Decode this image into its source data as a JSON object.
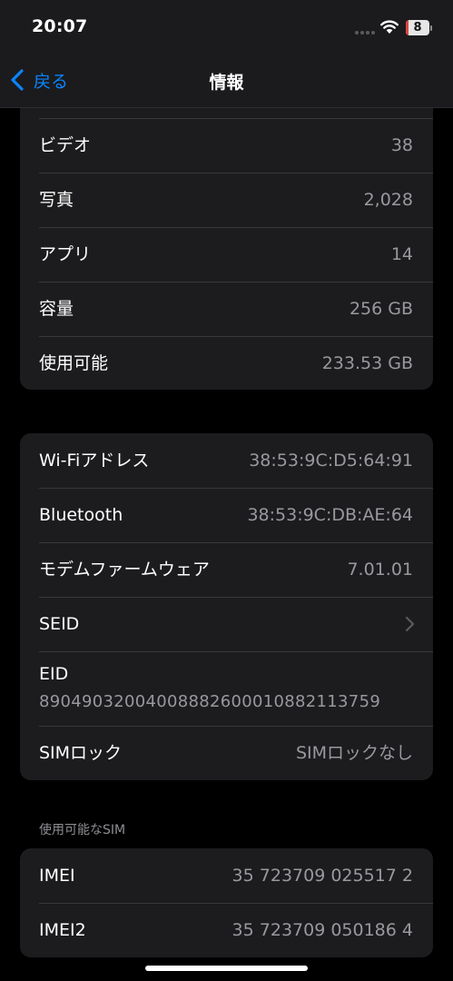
{
  "status_bar": {
    "time": "20:07",
    "battery_level": "8",
    "icons": [
      "signal-dots-icon",
      "wifi-icon",
      "battery-icon"
    ]
  },
  "nav": {
    "back_label": "戻る",
    "title": "情報"
  },
  "group1": {
    "rows": [
      {
        "label": "ビデオ",
        "value": "38"
      },
      {
        "label": "写真",
        "value": "2,028"
      },
      {
        "label": "アプリ",
        "value": "14"
      },
      {
        "label": "容量",
        "value": "256 GB"
      },
      {
        "label": "使用可能",
        "value": "233.53 GB"
      }
    ]
  },
  "group2": {
    "wifi": {
      "label": "Wi-Fiアドレス",
      "value": "38:53:9C:D5:64:91"
    },
    "bluetooth": {
      "label": "Bluetooth",
      "value": "38:53:9C:DB:AE:64"
    },
    "modem": {
      "label": "モデムファームウェア",
      "value": "7.01.01"
    },
    "seid": {
      "label": "SEID"
    },
    "eid": {
      "label": "EID",
      "value": "89049032004008882600010882113759"
    },
    "simlock": {
      "label": "SIMロック",
      "value": "SIMロックなし"
    }
  },
  "sim_section": {
    "header": "使用可能なSIM",
    "rows": [
      {
        "label": "IMEI",
        "value": "35 723709 025517 2"
      },
      {
        "label": "IMEI2",
        "value": "35 723709 050186 4"
      }
    ]
  },
  "colors": {
    "background": "#000000",
    "cell": "#1c1c1e",
    "accent": "#0a84ff",
    "secondary_text": "#98989f",
    "separator": "#38383a",
    "battery_low": "#e0443e"
  }
}
